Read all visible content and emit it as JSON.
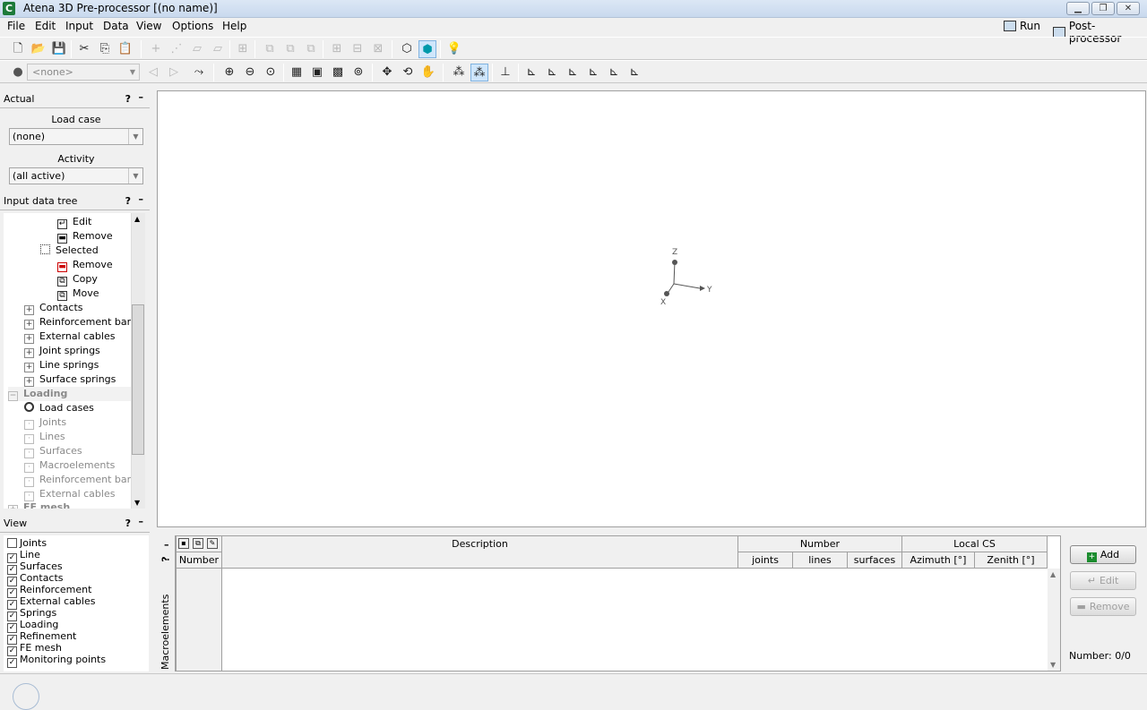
{
  "window": {
    "title": "Atena 3D Pre-processor [(no name)]",
    "icon": "app-c-icon"
  },
  "menu": {
    "items": [
      "File",
      "Edit",
      "Input",
      "Data",
      "View",
      "Options",
      "Help"
    ],
    "run": "Run",
    "post": "Post-processor"
  },
  "toolbar2": {
    "combo": "<none>"
  },
  "actual": {
    "title": "Actual",
    "help": "?",
    "minimize": "–",
    "load_case_label": "Load case",
    "load_case_value": "(none)",
    "activity_label": "Activity",
    "activity_value": "(all active)"
  },
  "tree": {
    "title": "Input data tree",
    "help": "?",
    "minimize": "–",
    "nodes": [
      "Edit",
      "Remove",
      "Selected",
      "Remove",
      "Copy",
      "Move",
      "Contacts",
      "Reinforcement bars",
      "External cables",
      "Joint springs",
      "Line springs",
      "Surface springs",
      "Loading",
      "Load cases",
      "Joints",
      "Lines",
      "Surfaces",
      "Macroelements",
      "Reinforcement bars",
      "External cables",
      "FE mesh"
    ]
  },
  "view": {
    "title": "View",
    "help": "?",
    "minimize": "–",
    "items": [
      {
        "label": "Joints",
        "checked": false
      },
      {
        "label": "Line",
        "checked": true
      },
      {
        "label": "Surfaces",
        "checked": true
      },
      {
        "label": "Contacts",
        "checked": true
      },
      {
        "label": "Reinforcement",
        "checked": true
      },
      {
        "label": "External cables",
        "checked": true
      },
      {
        "label": "Springs",
        "checked": true
      },
      {
        "label": "Loading",
        "checked": true
      },
      {
        "label": "Refinement",
        "checked": true
      },
      {
        "label": "FE mesh",
        "checked": true
      },
      {
        "label": "Monitoring points",
        "checked": true
      }
    ]
  },
  "axes": {
    "z": "Z",
    "y": "Y",
    "x": "X"
  },
  "bottom": {
    "tab": "Macroelements",
    "help": "?",
    "headers": {
      "number": "Number",
      "description": "Description",
      "number_group": "Number",
      "joints": "joints",
      "lines": "lines",
      "surfaces": "surfaces",
      "local_cs": "Local CS",
      "azimuth": "Azimuth [°]",
      "zenith": "Zenith [°]"
    },
    "add": "Add",
    "edit": "Edit",
    "remove": "Remove",
    "count": "Number: 0/0"
  }
}
